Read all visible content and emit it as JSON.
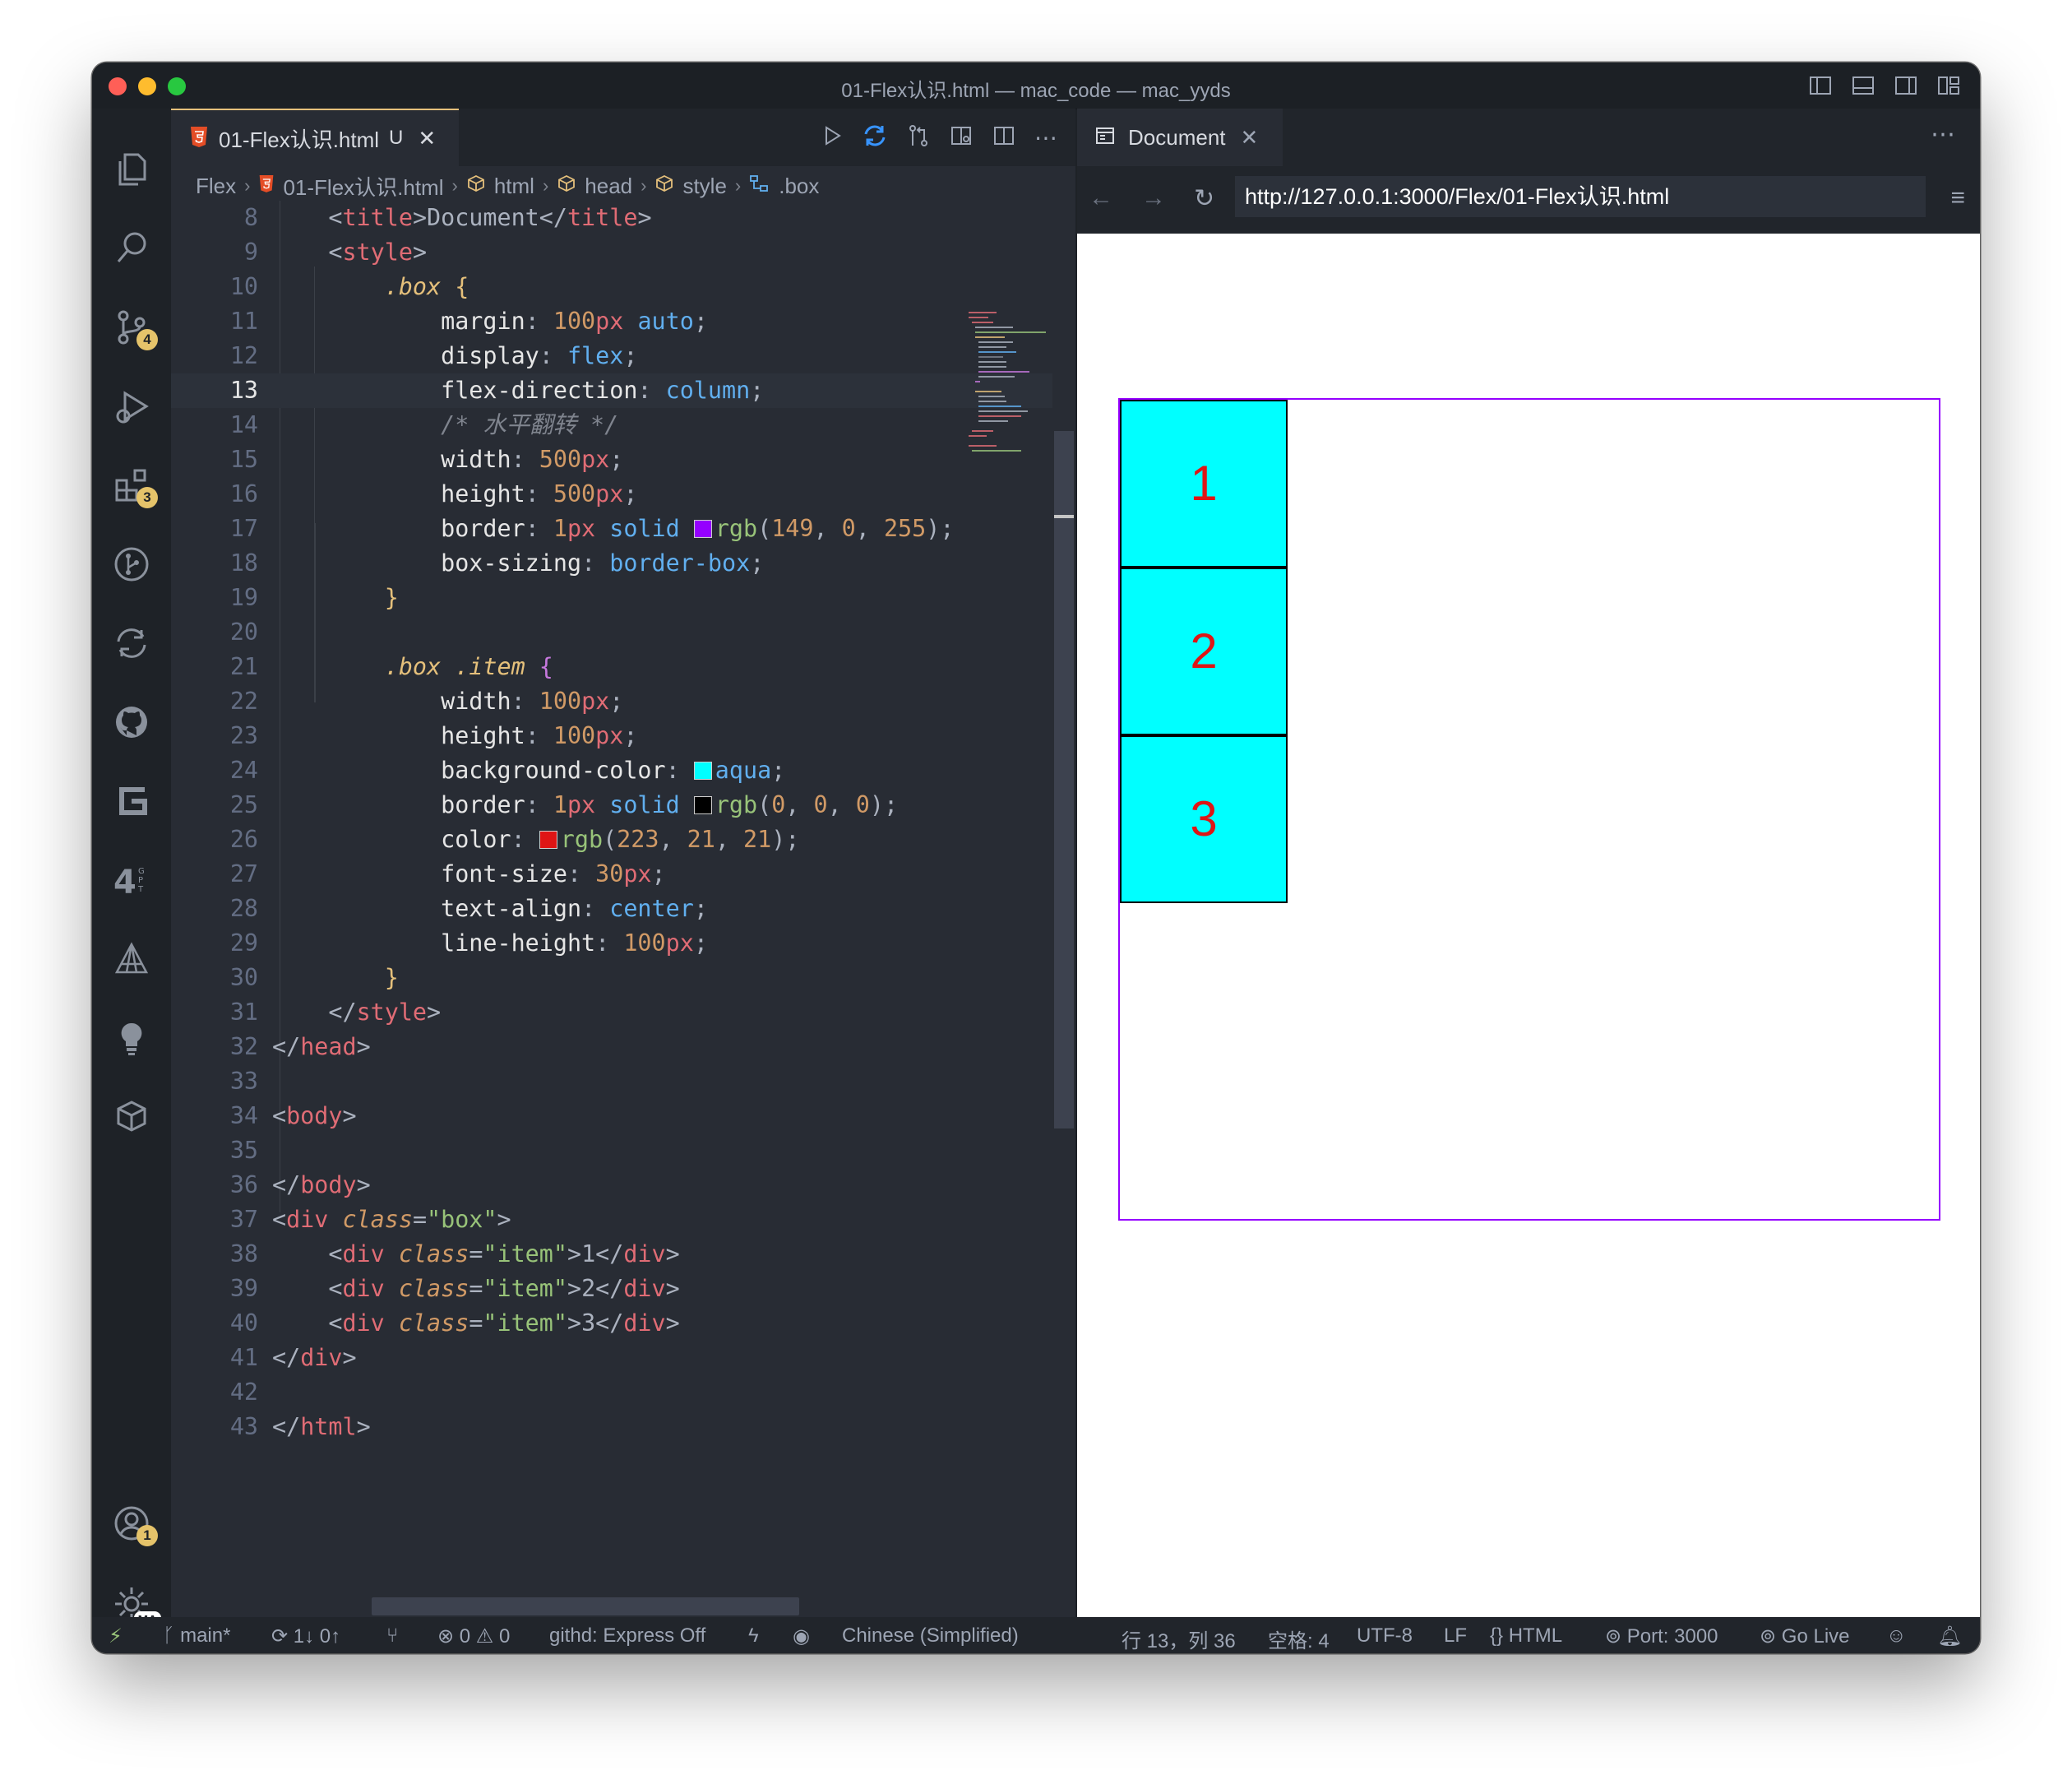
{
  "window": {
    "title": "01-Flex认识.html — mac_code — mac_yyds"
  },
  "activity_bar": {
    "scm_badge": "4",
    "extensions_badge": "3",
    "accounts_badge": "1",
    "manage_badge": "MA"
  },
  "editor": {
    "tab": {
      "label": "01-Flex认识.html",
      "status": "U"
    },
    "breadcrumb": [
      "Flex",
      "01-Flex认识.html",
      "html",
      "head",
      "style",
      ".box"
    ],
    "active_line": 13,
    "lines": [
      {
        "n": 8,
        "text": "    <title>Document</title>"
      },
      {
        "n": 9,
        "text": "    <style>"
      },
      {
        "n": 10,
        "text": "        .box {"
      },
      {
        "n": 11,
        "text": "            margin: 100px auto;"
      },
      {
        "n": 12,
        "text": "            display: flex;"
      },
      {
        "n": 13,
        "text": "            flex-direction: column;"
      },
      {
        "n": 14,
        "text": "            /* 水平翻转 */"
      },
      {
        "n": 15,
        "text": "            width: 500px;"
      },
      {
        "n": 16,
        "text": "            height: 500px;"
      },
      {
        "n": 17,
        "text": "            border: 1px solid rgb(149, 0, 255);"
      },
      {
        "n": 18,
        "text": "            box-sizing: border-box;"
      },
      {
        "n": 19,
        "text": "        }"
      },
      {
        "n": 20,
        "text": ""
      },
      {
        "n": 21,
        "text": "        .box .item {"
      },
      {
        "n": 22,
        "text": "            width: 100px;"
      },
      {
        "n": 23,
        "text": "            height: 100px;"
      },
      {
        "n": 24,
        "text": "            background-color: aqua;"
      },
      {
        "n": 25,
        "text": "            border: 1px solid rgb(0, 0, 0);"
      },
      {
        "n": 26,
        "text": "            color: rgb(223, 21, 21);"
      },
      {
        "n": 27,
        "text": "            font-size: 30px;"
      },
      {
        "n": 28,
        "text": "            text-align: center;"
      },
      {
        "n": 29,
        "text": "            line-height: 100px;"
      },
      {
        "n": 30,
        "text": "        }"
      },
      {
        "n": 31,
        "text": "    </style>"
      },
      {
        "n": 32,
        "text": "</head>"
      },
      {
        "n": 33,
        "text": ""
      },
      {
        "n": 34,
        "text": "<body>"
      },
      {
        "n": 35,
        "text": ""
      },
      {
        "n": 36,
        "text": "</body>"
      },
      {
        "n": 37,
        "text": "<div class=\"box\">"
      },
      {
        "n": 38,
        "text": "    <div class=\"item\">1</div>"
      },
      {
        "n": 39,
        "text": "    <div class=\"item\">2</div>"
      },
      {
        "n": 40,
        "text": "    <div class=\"item\">3</div>"
      },
      {
        "n": 41,
        "text": "</div>"
      },
      {
        "n": 42,
        "text": ""
      },
      {
        "n": 43,
        "text": "</html>"
      }
    ]
  },
  "browser": {
    "tab_label": "Document",
    "url": "http://127.0.0.1:3000/Flex/01-Flex认识.html",
    "items": [
      "1",
      "2",
      "3"
    ],
    "colors": {
      "box_border": "#9500ff",
      "item_bg": "#00ffff",
      "item_text": "#df1515"
    }
  },
  "status_bar": {
    "branch": "main*",
    "sync": "1↓ 0↑",
    "problems": "⊗ 0 ⚠ 0",
    "githd": "githd: Express Off",
    "language_pack": "Chinese (Simplified)",
    "cursor": "行 13，列 36",
    "spaces": "空格: 4",
    "encoding": "UTF-8",
    "eol": "LF",
    "language": "HTML",
    "port": "Port: 3000",
    "go_live": "Go Live"
  }
}
